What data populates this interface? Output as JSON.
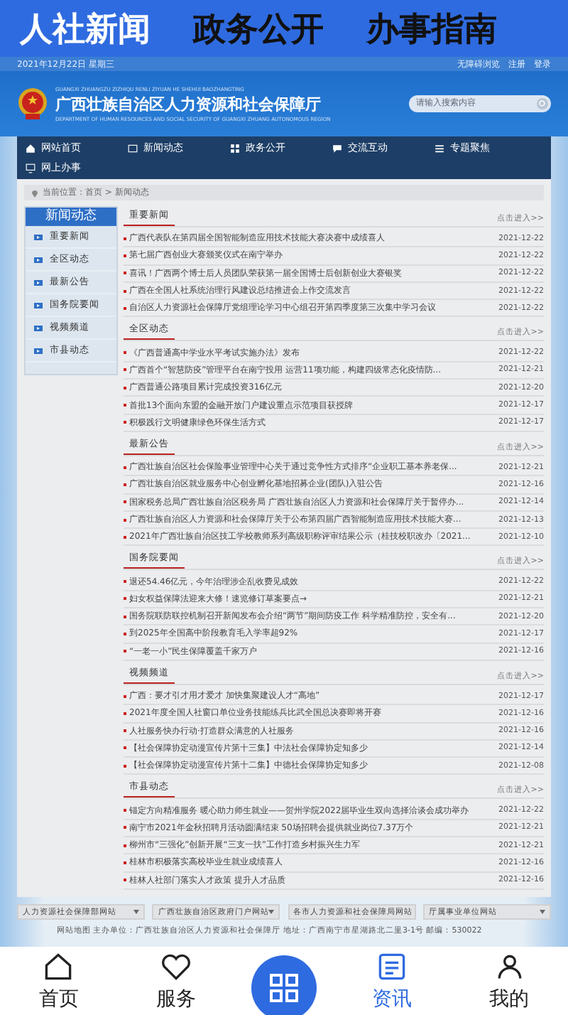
{
  "app_tabs": [
    {
      "label": "人社新闻",
      "selected": true
    },
    {
      "label": "政务公开",
      "selected": false
    },
    {
      "label": "办事指南",
      "selected": false
    }
  ],
  "site": {
    "top_bar": {
      "date": "2021年12月22日 星期三",
      "links": [
        "无障碍浏览",
        "注册",
        "登录"
      ]
    },
    "header": {
      "pinyin": "GUANGXI ZHUANGZU ZIZHIQU RENLI ZIYUAN HE SHEHUI BAOZHANGTING",
      "title": "广西壮族自治区人力资源和社会保障厅",
      "english": "DEPARTMENT OF HUMAN RESOURCES AND SOCIAL SECURITY OF GUANGXI ZHUANG AUTONOMOUS REGION",
      "search": {
        "placeholder": "请输入搜索内容"
      }
    },
    "nav": [
      {
        "label": "网站首页"
      },
      {
        "label": "新闻动态"
      },
      {
        "label": "政务公开"
      },
      {
        "label": "交流互动"
      },
      {
        "label": "专题聚焦"
      },
      {
        "label": "网上办事"
      }
    ],
    "breadcrumb": "当前位置：首页 > 新闻动态",
    "sidebar": {
      "title": "新闻动态",
      "items": [
        "重要新闻",
        "全区动态",
        "最新公告",
        "国务院要闻",
        "视频频道",
        "市县动态"
      ]
    },
    "sections": [
      {
        "title": "重要新闻",
        "more": "点击进入>>",
        "items": [
          {
            "title": "广西代表队在第四届全国智能制造应用技术技能大赛决赛中成绩喜人",
            "date": "2021-12-22"
          },
          {
            "title": "第七届广西创业大赛颁奖仪式在南宁举办",
            "date": "2021-12-22"
          },
          {
            "title": "喜讯！广西两个博士后人员团队荣获第一届全国博士后创新创业大赛银奖",
            "date": "2021-12-22"
          },
          {
            "title": "广西在全国人社系统治理行风建设总结推进会上作交流发言",
            "date": "2021-12-22"
          },
          {
            "title": "自治区人力资源社会保障厅党组理论学习中心组召开第四季度第三次集中学习会议",
            "date": "2021-12-22"
          }
        ]
      },
      {
        "title": "全区动态",
        "more": "点击进入>>",
        "items": [
          {
            "title": "《广西普通高中学业水平考试实施办法》发布",
            "date": "2021-12-22"
          },
          {
            "title": "广西首个“智慧防疫”管理平台在南宁投用 运营11项功能，构建四级常态化疫情防...",
            "date": "2021-12-21"
          },
          {
            "title": "广西普通公路项目累计完成投资316亿元",
            "date": "2021-12-20"
          },
          {
            "title": "首批13个面向东盟的金融开放门户建设重点示范项目获授牌",
            "date": "2021-12-17"
          },
          {
            "title": "积极践行文明健康绿色环保生活方式",
            "date": "2021-12-17"
          }
        ]
      },
      {
        "title": "最新公告",
        "more": "点击进入>>",
        "items": [
          {
            "title": "广西壮族自治区社会保险事业管理中心关于通过竞争性方式排序“企业职工基本养老保...",
            "date": "2021-12-21"
          },
          {
            "title": "广西壮族自治区就业服务中心创业孵化基地招募企业(团队)入驻公告",
            "date": "2021-12-16"
          },
          {
            "title": "国家税务总局广西壮族自治区税务局 广西壮族自治区人力资源和社会保障厅关于暂停办...",
            "date": "2021-12-14"
          },
          {
            "title": "广西壮族自治区人力资源和社会保障厅关于公布第四届广西智能制造应用技术技能大赛...",
            "date": "2021-12-13"
          },
          {
            "title": "2021年广西壮族自治区技工学校教师系列高级职称评审结果公示（桂技校职改办〔2021...",
            "date": "2021-12-10"
          }
        ]
      },
      {
        "title": "国务院要闻",
        "more": "点击进入>>",
        "items": [
          {
            "title": "退还54.46亿元，今年治理涉企乱收费见成效",
            "date": "2021-12-22"
          },
          {
            "title": "妇女权益保障法迎来大修！速览修订草案要点→",
            "date": "2021-12-21"
          },
          {
            "title": "国务院联防联控机制召开新闻发布会介绍“两节”期间防疫工作 科学精准防控，安全有...",
            "date": "2021-12-20"
          },
          {
            "title": "到2025年全国高中阶段教育毛入学率超92%",
            "date": "2021-12-17"
          },
          {
            "title": "“一老一小”民生保障覆盖千家万户",
            "date": "2021-12-16"
          }
        ]
      },
      {
        "title": "视频频道",
        "more": "点击进入>>",
        "items": [
          {
            "title": "广西：要才引才用才爱才 加快集聚建设人才“高地”",
            "date": "2021-12-17"
          },
          {
            "title": "2021年度全国人社窗口单位业务技能练兵比武全国总决赛即将开赛",
            "date": "2021-12-16"
          },
          {
            "title": "人社服务快办行动·打造群众满意的人社服务",
            "date": "2021-12-16"
          },
          {
            "title": "【社会保障协定动漫宣传片第十三集】中法社会保障协定知多少",
            "date": "2021-12-14"
          },
          {
            "title": "【社会保障协定动漫宣传片第十二集】中德社会保障协定知多少",
            "date": "2021-12-08"
          }
        ]
      },
      {
        "title": "市县动态",
        "more": "点击进入>>",
        "items": [
          {
            "title": "锚定方向精准服务 暖心助力师生就业——贺州学院2022届毕业生双向选择洽谈会成功举办",
            "date": "2021-12-22"
          },
          {
            "title": "南宁市2021年金秋招聘月活动圆满结束 50场招聘会提供就业岗位7.37万个",
            "date": "2021-12-21"
          },
          {
            "title": "柳州市“三强化”创新开展“三支一扶”工作打造乡村振兴生力军",
            "date": "2021-12-21"
          },
          {
            "title": "桂林市积极落实高校毕业生就业成绩喜人",
            "date": "2021-12-16"
          },
          {
            "title": "桂林人社部门落实人才政策 提升人才品质",
            "date": "2021-12-16"
          }
        ]
      }
    ],
    "link_selects": [
      "人力资源社会保障部网站",
      "广西壮族自治区政府门户网站",
      "各市人力资源和社会保障局网站",
      "厅属事业单位网站"
    ],
    "footer": "网站地图 主办单位：广西壮族自治区人力资源和社会保障厅 地址：广西南宁市星湖路北二里3-1号 邮编：530022"
  },
  "bottom_nav": [
    {
      "kind": "tab",
      "label": "首页",
      "selected": false
    },
    {
      "kind": "tab",
      "label": "服务",
      "selected": false
    },
    {
      "kind": "action"
    },
    {
      "kind": "tab",
      "label": "资讯",
      "selected": true
    },
    {
      "kind": "tab",
      "label": "我的",
      "selected": false
    }
  ]
}
